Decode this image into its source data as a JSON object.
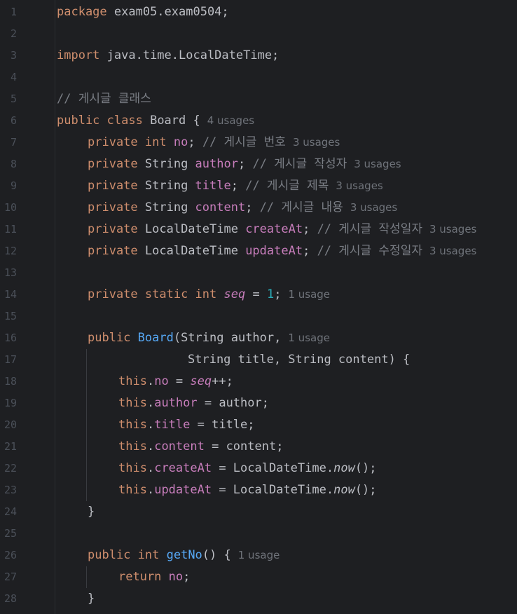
{
  "gutter": {
    "line_numbers": [
      "1",
      "2",
      "3",
      "4",
      "5",
      "6",
      "7",
      "8",
      "9",
      "10",
      "11",
      "12",
      "13",
      "14",
      "15",
      "16",
      "17",
      "18",
      "19",
      "20",
      "21",
      "22",
      "23",
      "24",
      "25",
      "26",
      "27",
      "28"
    ]
  },
  "code": {
    "l1": {
      "kw": "package",
      "rest": " exam05.exam0504;"
    },
    "l3": {
      "kw": "import",
      "rest": " java.time.LocalDateTime;"
    },
    "l5": {
      "comment": "// 게시글 클래스"
    },
    "l6": {
      "kw1": "public",
      "kw2": " class",
      "rest": " Board {",
      "hint": "4 usages"
    },
    "l7": {
      "kw1": "private",
      "kw2": " int",
      "field": " no",
      "rest": ";",
      "comment": " // 게시글 번호",
      "hint": "3 usages"
    },
    "l8": {
      "kw1": "private",
      "type": " String",
      "field": " author",
      "rest": ";",
      "comment": " // 게시글 작성자",
      "hint": "3 usages"
    },
    "l9": {
      "kw1": "private",
      "type": " String",
      "field": " title",
      "rest": ";",
      "comment": " // 게시글 제목",
      "hint": "3 usages"
    },
    "l10": {
      "kw1": "private",
      "type": " String",
      "field": " content",
      "rest": ";",
      "comment": " // 게시글 내용",
      "hint": "3 usages"
    },
    "l11": {
      "kw1": "private",
      "type": " LocalDateTime",
      "field": " createAt",
      "rest": ";",
      "comment": " // 게시글 작성일자",
      "hint": "3 usages"
    },
    "l12": {
      "kw1": "private",
      "type": " LocalDateTime",
      "field": " updateAt",
      "rest": ";",
      "comment": " // 게시글 수정일자",
      "hint": "3 usages"
    },
    "l14": {
      "kw1": "private",
      "kw2": " static",
      "kw3": " int",
      "field": " seq",
      "eq": " = ",
      "num": "1",
      "rest": ";",
      "hint": "1 usage"
    },
    "l16": {
      "kw1": "public",
      "ctor": " Board",
      "rest": "(String author,",
      "hint": "1 usage"
    },
    "l17": {
      "rest": "String title, String content) {"
    },
    "l18": {
      "kw": "this",
      "dot": ".",
      "field": "no",
      "eq": " = ",
      "field2": "seq",
      "rest": "++;"
    },
    "l19": {
      "kw": "this",
      "dot": ".",
      "field": "author",
      "rest": " = author;"
    },
    "l20": {
      "kw": "this",
      "dot": ".",
      "field": "title",
      "rest": " = title;"
    },
    "l21": {
      "kw": "this",
      "dot": ".",
      "field": "content",
      "rest": " = content;"
    },
    "l22": {
      "kw": "this",
      "dot": ".",
      "field": "createAt",
      "rest": " = LocalDateTime.",
      "call": "now",
      "end": "();"
    },
    "l23": {
      "kw": "this",
      "dot": ".",
      "field": "updateAt",
      "rest": " = LocalDateTime.",
      "call": "now",
      "end": "();"
    },
    "l24": {
      "rest": "}"
    },
    "l26": {
      "kw1": "public",
      "kw2": " int",
      "fn": " getNo",
      "rest": "() {",
      "hint": "1 usage"
    },
    "l27": {
      "kw": "return",
      "field": " no",
      "rest": ";"
    },
    "l28": {
      "rest": "}"
    }
  },
  "colors": {
    "background": "#1e1f22",
    "keyword": "#cf8e6d",
    "field": "#c77dbb",
    "number": "#2aacb8",
    "function": "#56a8f5",
    "comment": "#7a7e85",
    "hint": "#6f737a",
    "line_number": "#4b5059",
    "text": "#bcbec4"
  }
}
